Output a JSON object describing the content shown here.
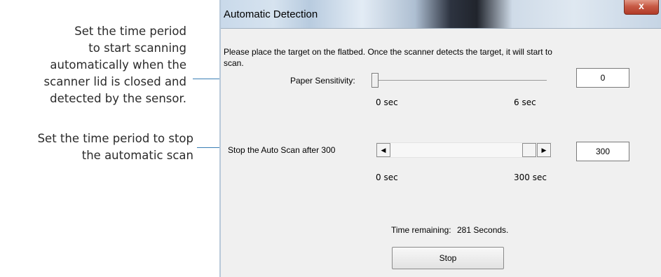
{
  "annotations": {
    "callout_1": [
      "Set the time period",
      "to start scanning",
      "automatically when the",
      "scanner lid is closed and",
      "detected by the sensor."
    ],
    "callout_2": [
      "Set the time period to stop",
      "the automatic scan"
    ]
  },
  "window": {
    "title": "Automatic Detection",
    "close_glyph": "x"
  },
  "dialog": {
    "instruction_line1": "Please place the target on the flatbed. Once the scanner detects the target, it will start to",
    "instruction_line2": "scan.",
    "paper_sensitivity": {
      "label": "Paper Sensitivity:",
      "min_label": "0 sec",
      "max_label": "6 sec",
      "value": "0",
      "slider_fraction": 0.0
    },
    "auto_scan": {
      "label": "Stop the Auto Scan after 300",
      "min_label": "0 sec",
      "max_label": "300 sec",
      "value": "300",
      "scroll_left_glyph": "◀",
      "scroll_right_glyph": "▶",
      "scroll_fraction": 1.0
    },
    "time_remaining": {
      "label": "Time remaining:",
      "value": "281 Seconds."
    },
    "stop_button": "Stop"
  },
  "colors": {
    "leader_line": "#3a7fb5",
    "close_button": "#c75a45"
  }
}
